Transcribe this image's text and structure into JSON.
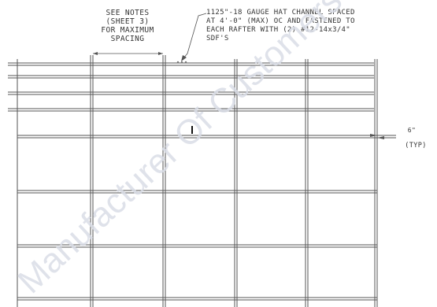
{
  "notes": {
    "lines": [
      "SEE NOTES",
      "(SHEET 3)",
      "FOR MAXIMUM",
      "SPACING"
    ]
  },
  "callout": {
    "lines": [
      "1125\"-18 GAUGE HAT CHANNEL SPACED",
      "AT 4'-0\" (MAX) OC AND FASTENED TO",
      "EACH RAFTER WITH (2) #12-14x3/4\"",
      "SDF'S"
    ]
  },
  "dimension": {
    "value": "6\"",
    "qualifier": "(TYP)"
  },
  "watermark": {
    "text": "Manufacturer Of Customers",
    "color": "#d9dde6"
  },
  "colors": {
    "line": "#555555",
    "background": "#ffffff"
  }
}
